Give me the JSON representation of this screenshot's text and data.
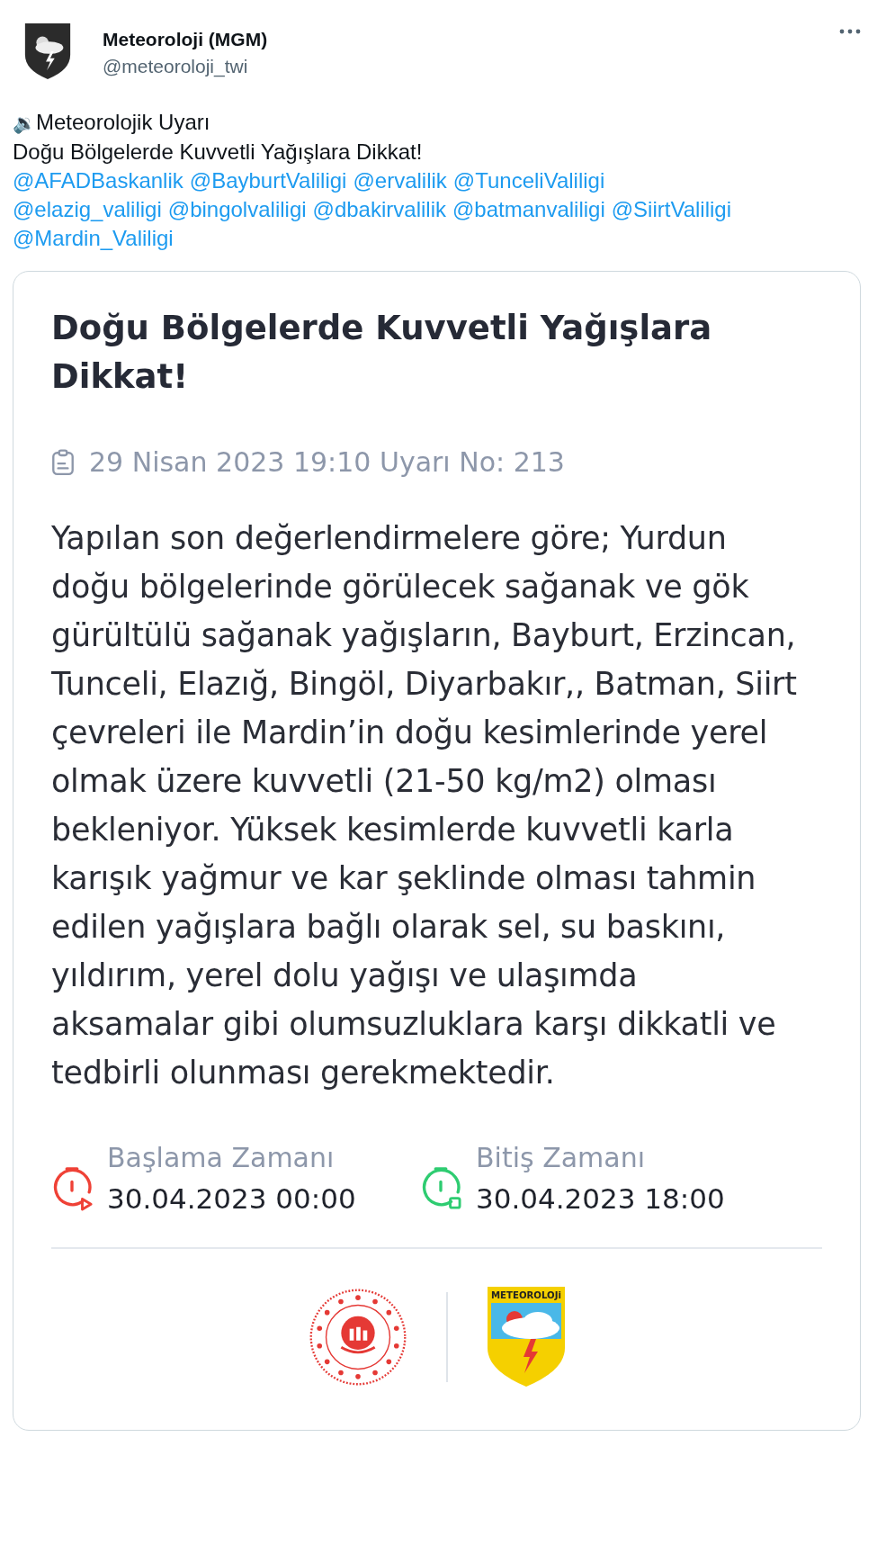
{
  "author": {
    "name": "Meteoroloji (MGM)",
    "handle": "@meteoroloji_twi"
  },
  "tweet": {
    "icon_glyph": "🔉",
    "heading": "Meteorolojik Uyarı",
    "subheading": "Doğu Bölgelerde Kuvvetli Yağışlara Dikkat!",
    "mentions": [
      "@AFADBaskanlik",
      "@BayburtValiligi",
      "@ervalilik",
      "@TunceliValiligi",
      "@elazig_valiligi",
      "@bingolvaliligi",
      "@dbakirvalilik",
      "@batmanvaliligi",
      "@SiirtValiligi",
      "@Mardin_Valiligi"
    ]
  },
  "card": {
    "title": "Doğu Bölgelerde Kuvvetli Yağışlara Dikkat!",
    "date": "29 Nisan 2023 19:10 Uyarı No: 213",
    "body": "Yapılan son değerlendirmelere göre; Yurdun doğu bölgelerinde görülecek sağanak ve gök gürültülü sağanak yağışların, Bayburt, Erzincan, Tunceli, Elazığ, Bingöl, Diyarbakır,, Batman, Siirt çevreleri ile Mardin’in doğu kesimlerinde yerel olmak üzere kuvvetli (21-50 kg/m2) olması bekleniyor. Yüksek kesimlerde kuvvetli karla karışık yağmur ve kar şeklinde olması tahmin edilen yağışlara bağlı olarak sel, su baskını, yıldırım, yerel dolu yağışı ve ulaşımda aksamalar gibi olumsuzluklara karşı dikkatli ve tedbirli olunması gerekmektedir.",
    "times": [
      {
        "kind": "start",
        "label": "Başlama Zamanı",
        "value": "30.04.2023 00:00"
      },
      {
        "kind": "end",
        "label": "Bitiş Zamanı",
        "value": "30.04.2023 18:00"
      }
    ],
    "logo_text": "METEOROLOJi"
  }
}
